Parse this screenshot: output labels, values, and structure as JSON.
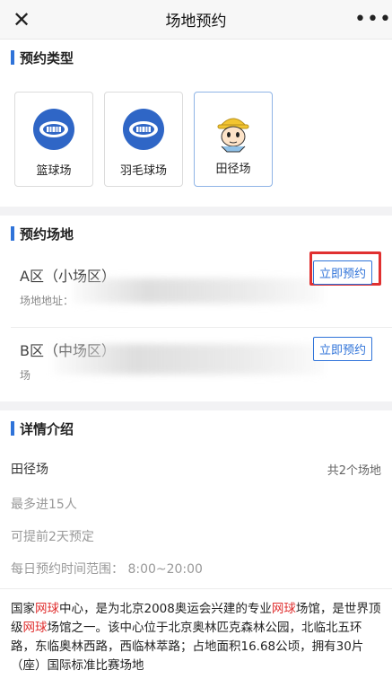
{
  "topbar": {
    "title": "场地预约",
    "close_icon": "close-icon",
    "more_icon": "more-icon"
  },
  "type_section": {
    "title": "预约类型",
    "items": [
      {
        "label": "篮球场",
        "icon": "stadium-icon"
      },
      {
        "label": "羽毛球场",
        "icon": "stadium-icon"
      },
      {
        "label": "田径场",
        "icon": "cartoon-avatar-icon",
        "active": true
      }
    ]
  },
  "venue_section": {
    "title": "预约场地",
    "venues": [
      {
        "name": "A区（小场区）",
        "address": "场地地址：",
        "button": "立即预约"
      },
      {
        "name": "B区（中场区）",
        "address": "场",
        "button": "立即预约"
      }
    ]
  },
  "detail_section": {
    "title": "详情介绍",
    "name": "田径场",
    "count": "共2个场地",
    "max_people": "最多进15人",
    "advance": "可提前2天预定",
    "time_range": "每日预约时间范围：  8:00~20:00",
    "description_parts": [
      "国家",
      "网球",
      "中心，是为北京2008奥运会兴建的专业",
      "网球",
      "场馆，是世界顶级",
      "网球",
      "场馆之一。该中心位于北京奥林匹克森林公园，北临北五环路，东临奥林西路，西临林萃路；占地面积16.68公顷，拥有30片（座）国际标准比赛场地"
    ]
  },
  "colors": {
    "accent": "#2f73d9",
    "highlight": "#e03030"
  }
}
